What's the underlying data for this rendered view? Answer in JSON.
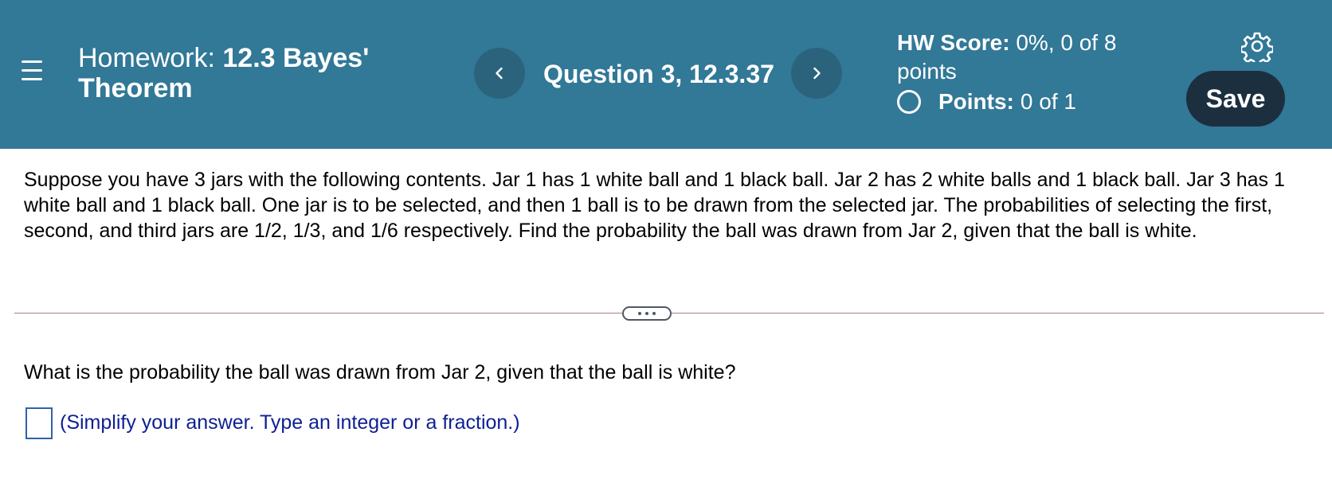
{
  "header": {
    "title_prefix": "Homework:",
    "title_name": "12.3 Bayes' Theorem",
    "question_label": "Question 3, 12.3.37",
    "score_label": "HW Score:",
    "score_value": "0%, 0 of 8 points",
    "points_label": "Points:",
    "points_value": "0 of 1",
    "save_label": "Save",
    "icons": {
      "menu": "hamburger-menu-icon",
      "prev": "chevron-left-icon",
      "next": "chevron-right-icon",
      "status": "circle-outline-icon",
      "settings": "gear-icon"
    },
    "colors": {
      "header_bg": "#327897",
      "nav_button_bg": "#2b637d",
      "save_button_bg": "#1c2f3f"
    }
  },
  "problem": {
    "text": "Suppose you have 3 jars with the following contents. Jar 1 has 1 white ball and 1 black ball. Jar 2 has 2 white balls and 1 black ball. Jar 3 has 1 white ball and 1 black ball. One jar is to be selected, and then 1 ball is to be drawn from the selected jar. The probabilities of selecting the first, second, and third jars are 1/2, 1/3, and 1/6 respectively. Find the probability the ball was drawn from Jar 2, given that the ball is white."
  },
  "answer": {
    "question": "What is the probability the ball was drawn from Jar 2, given that the ball is white?",
    "hint": "(Simplify your answer. Type an integer or a fraction.)",
    "value": "",
    "hint_color": "#0f2094"
  }
}
